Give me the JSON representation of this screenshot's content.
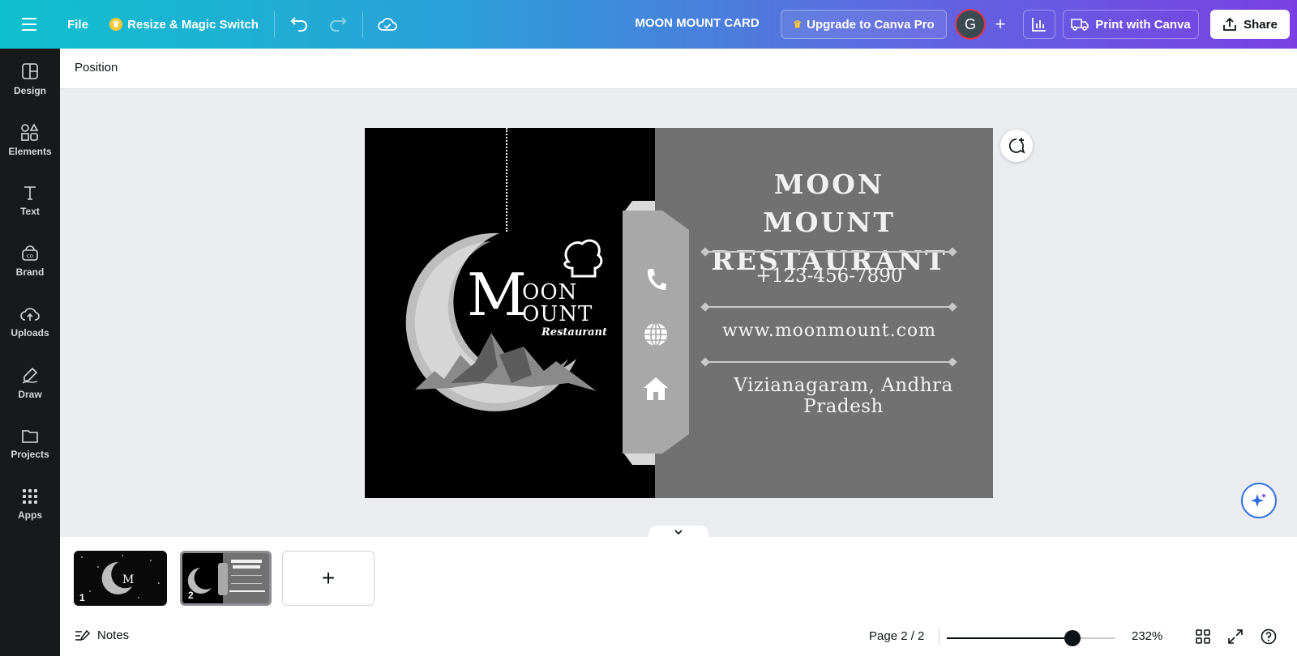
{
  "topbar": {
    "file_label": "File",
    "magic_label": "Resize & Magic Switch",
    "doc_title": "MOON MOUNT CARD",
    "upgrade_label": "Upgrade to Canva Pro",
    "avatar_initial": "G",
    "print_label": "Print with Canva",
    "share_label": "Share"
  },
  "sidebar": {
    "items": [
      {
        "label": "Design",
        "icon": "design-icon"
      },
      {
        "label": "Elements",
        "icon": "elements-icon"
      },
      {
        "label": "Text",
        "icon": "text-icon"
      },
      {
        "label": "Brand",
        "icon": "brand-icon"
      },
      {
        "label": "Uploads",
        "icon": "uploads-icon"
      },
      {
        "label": "Draw",
        "icon": "draw-icon"
      },
      {
        "label": "Projects",
        "icon": "projects-icon"
      },
      {
        "label": "Apps",
        "icon": "apps-icon"
      }
    ]
  },
  "subtoolbar": {
    "position_label": "Position"
  },
  "card": {
    "title_line1": "MOON MOUNT",
    "title_line2": "RESTAURANT",
    "phone": "+123-456-7890",
    "website": "www.moonmount.com",
    "address": "Vizianagaram, Andhra Pradesh",
    "logo": {
      "m": "M",
      "oon": "OON",
      "ount": "OUNT",
      "restaurant": "Restaurant"
    },
    "colors": {
      "left_bg": "#000000",
      "right_bg": "#717171",
      "tab": "#a8a8a8"
    }
  },
  "pages": {
    "thumbs": [
      {
        "number": "1"
      },
      {
        "number": "2"
      }
    ],
    "add_label": "+"
  },
  "footer": {
    "notes_label": "Notes",
    "page_indicator": "Page 2 / 2",
    "zoom_label": "232%",
    "zoom_fraction": 0.75
  }
}
